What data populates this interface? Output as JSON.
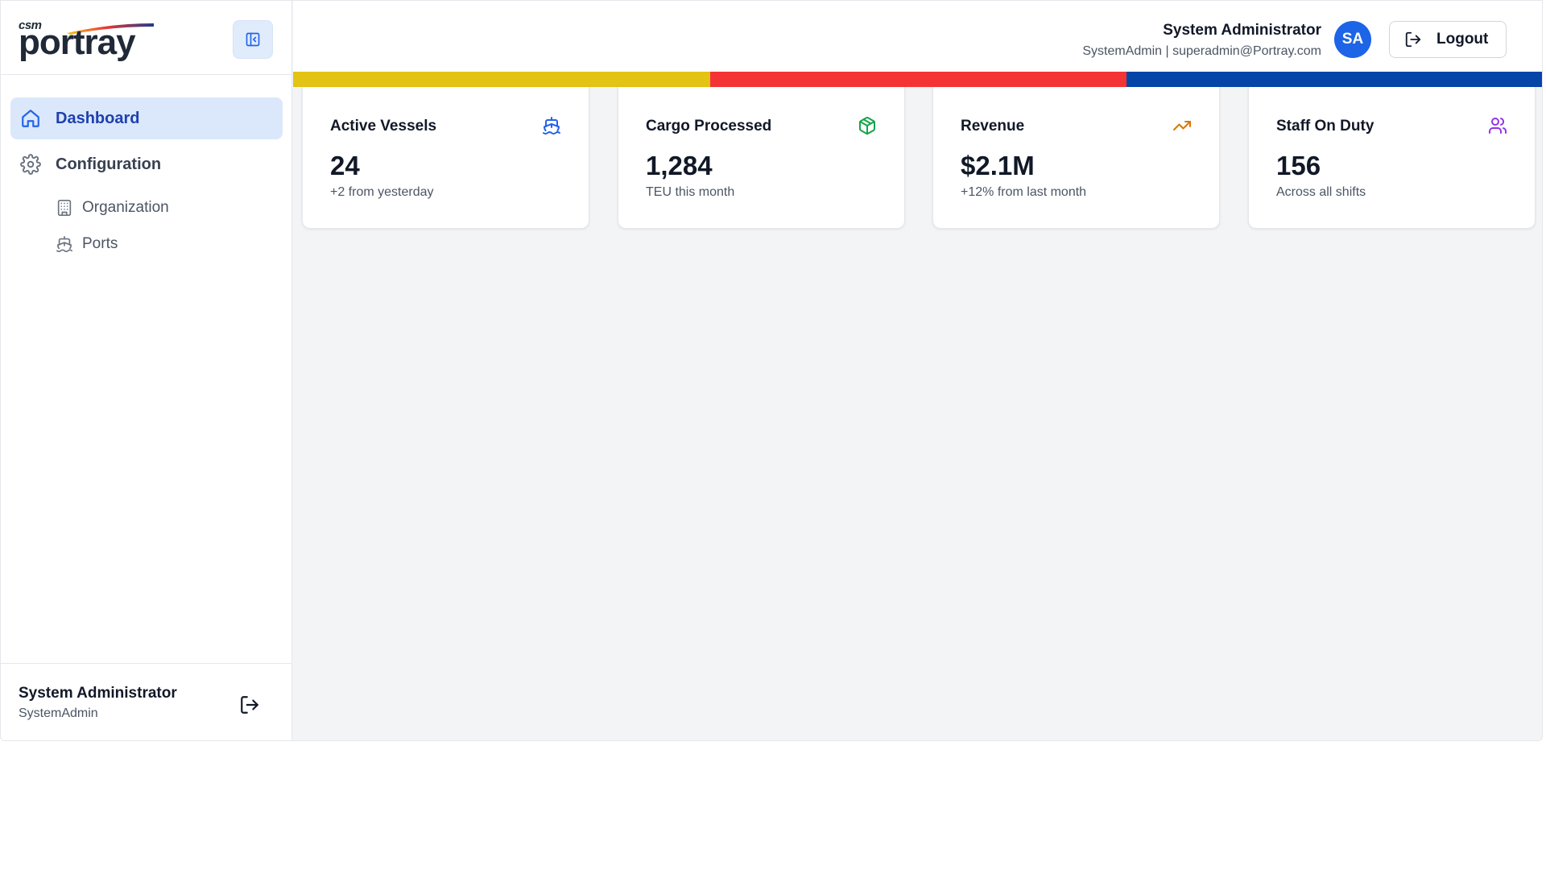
{
  "brand": {
    "small": "csm",
    "name": "portray"
  },
  "sidebar": {
    "items": [
      {
        "label": "Dashboard",
        "icon": "home-icon",
        "active": true
      },
      {
        "label": "Configuration",
        "icon": "gear-icon",
        "active": false
      }
    ],
    "subitems": [
      {
        "label": "Organization",
        "icon": "building-icon"
      },
      {
        "label": "Ports",
        "icon": "ship-icon"
      }
    ],
    "footer": {
      "name": "System Administrator",
      "role": "SystemAdmin"
    }
  },
  "header": {
    "user_name": "System Administrator",
    "user_meta": "SystemAdmin | superadmin@Portray.com",
    "avatar_initials": "SA",
    "logout_label": "Logout"
  },
  "stripe_colors": [
    "#e3c313",
    "#f43434",
    "#0545a8"
  ],
  "cards": [
    {
      "title": "Active Vessels",
      "value": "24",
      "subtitle": "+2 from yesterday",
      "icon": "ship-icon",
      "color": "#2563eb"
    },
    {
      "title": "Cargo Processed",
      "value": "1,284",
      "subtitle": "TEU this month",
      "icon": "package-icon",
      "color": "#16a34a"
    },
    {
      "title": "Revenue",
      "value": "$2.1M",
      "subtitle": "+12% from last month",
      "icon": "trending-up-icon",
      "color": "#d97706"
    },
    {
      "title": "Staff On Duty",
      "value": "156",
      "subtitle": "Across all shifts",
      "icon": "users-icon",
      "color": "#9333ea"
    }
  ]
}
